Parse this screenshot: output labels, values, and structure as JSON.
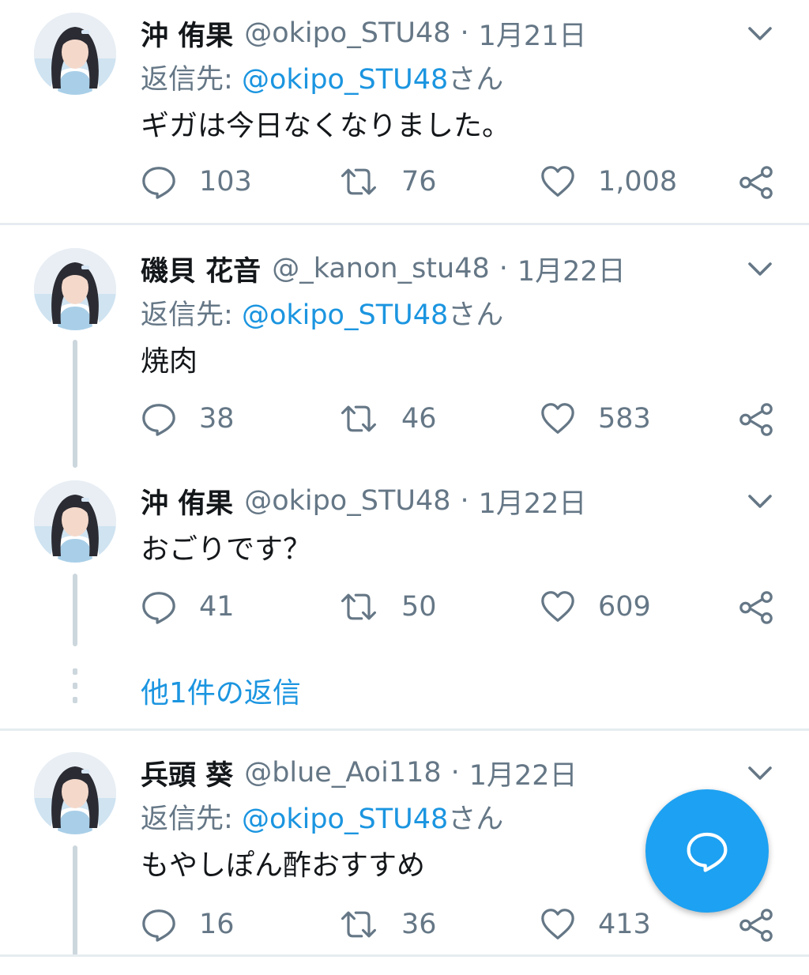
{
  "colors": {
    "accent": "#1da1f2",
    "link": "#1b95e0",
    "muted": "#657786",
    "text": "#14171a"
  },
  "tweets": [
    {
      "name": "沖 侑果",
      "handle": "@okipo_STU48",
      "date": "1月21日",
      "reply_prefix": "返信先:",
      "reply_mention": "@okipo_STU48",
      "reply_suffix": "さん",
      "text": "ギガは今日なくなりました。",
      "replies": "103",
      "retweets": "76",
      "likes": "1,008"
    },
    {
      "name": "磯貝 花音",
      "handle": "@_kanon_stu48",
      "date": "1月22日",
      "reply_prefix": "返信先:",
      "reply_mention": "@okipo_STU48",
      "reply_suffix": "さん",
      "text": "焼肉",
      "replies": "38",
      "retweets": "46",
      "likes": "583"
    },
    {
      "name": "沖 侑果",
      "handle": "@okipo_STU48",
      "date": "1月22日",
      "text": "おごりです？",
      "replies": "41",
      "retweets": "50",
      "likes": "609"
    },
    {
      "name": "兵頭 葵",
      "handle": "@blue_Aoi118",
      "date": "1月22日",
      "reply_prefix": "返信先:",
      "reply_mention": "@okipo_STU48",
      "reply_suffix": "さん",
      "text": "もやしぽん酢おすすめ",
      "replies": "16",
      "retweets": "36",
      "likes": "413"
    }
  ],
  "more_replies": "他1件の返信",
  "separator_dot": "·",
  "icons": {
    "reply": "reply-icon",
    "retweet": "retweet-icon",
    "like": "heart-icon",
    "share": "share-icon",
    "menu": "chevron-down-icon",
    "compose": "compose-reply-icon"
  }
}
